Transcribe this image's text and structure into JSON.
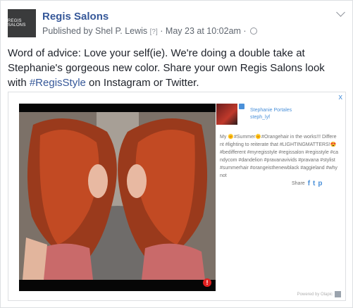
{
  "post": {
    "page_name": "Regis Salons",
    "avatar_text": "REGIS SALONS",
    "published_by": "Published by Shel P. Lewis",
    "help_marker": "[?]",
    "separator": "·",
    "date": "May 23 at 10:02am",
    "text_main": "Word of advice: Love your self(ie). We're doing a double take at Stephanie's gorgeous new color. Share your own Regis Salons look with ",
    "hashtag": "#RegisStyle",
    "text_tail": " on Instagram or Twitter."
  },
  "embed": {
    "ad_x": "x",
    "user_name": "Stephanie Portales",
    "user_handle": "steph_lyf",
    "caption": "My 🌞#Summer🌞#Orangehair in the works!!! Different #lighting to reiterate that #LIGHTINGMATTERS!😍#bedifferent #myregisstyle #regissalon #regisstyle #candycom #dandelion #pravanavivids #pravana #stylist #summerhair #orangeisthenewblack #aggieland #whynot",
    "share_label": "Share",
    "share_icons": [
      "f",
      "t",
      "p"
    ],
    "alert_mark": "!",
    "powered_by": "Powered by Olapic"
  },
  "colors": {
    "link": "#365899",
    "accent": "#4a90d9",
    "alert": "#e02020"
  }
}
